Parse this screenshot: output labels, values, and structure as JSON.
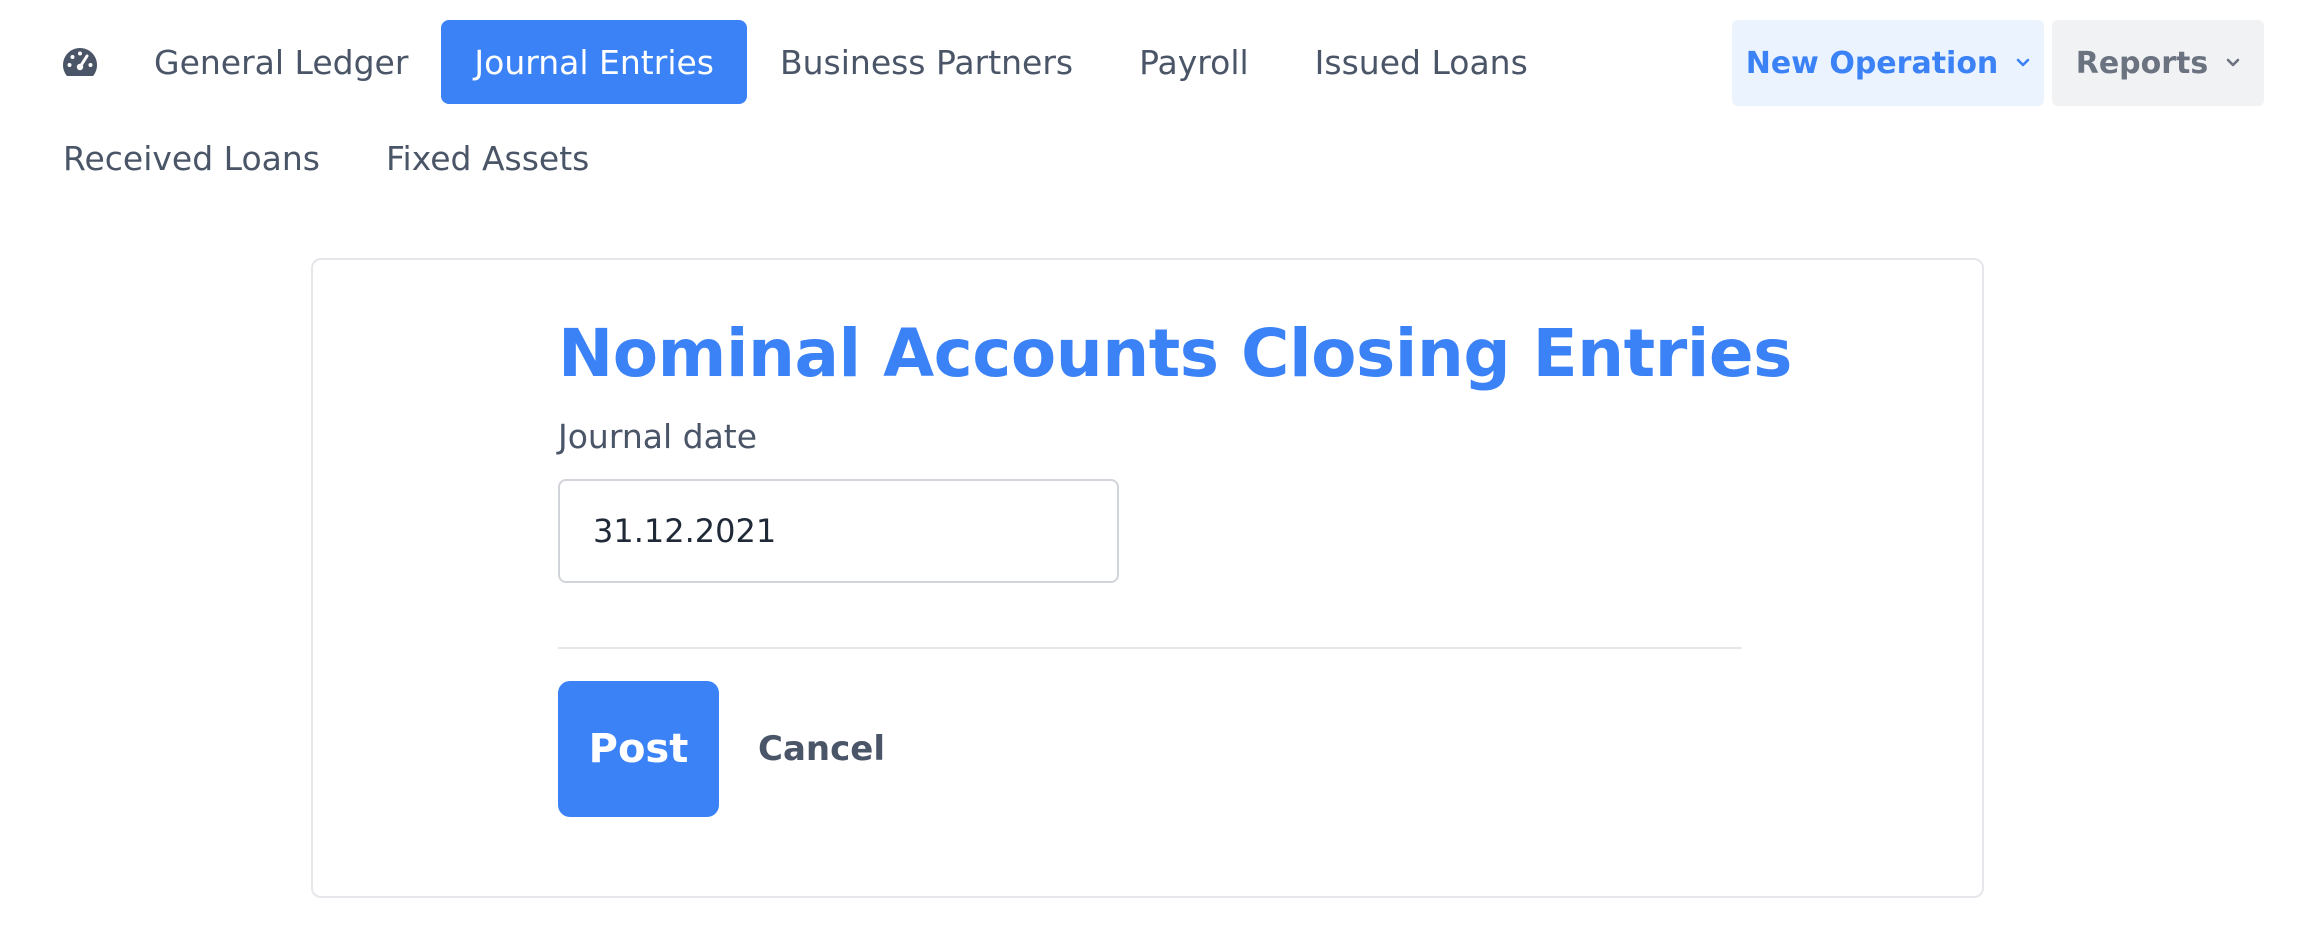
{
  "nav": {
    "dashboard_icon": "dashboard-gauge-icon",
    "row1": [
      {
        "label": "General Ledger",
        "active": false
      },
      {
        "label": "Journal Entries",
        "active": true
      },
      {
        "label": "Business Partners",
        "active": false
      },
      {
        "label": "Payroll",
        "active": false
      },
      {
        "label": "Issued Loans",
        "active": false
      }
    ],
    "row2": [
      {
        "label": "Received Loans",
        "active": false
      },
      {
        "label": "Fixed Assets",
        "active": false
      }
    ],
    "actions": {
      "new_operation": "New Operation",
      "reports": "Reports"
    }
  },
  "form": {
    "title": "Nominal Accounts Closing Entries",
    "journal_date_label": "Journal date",
    "journal_date_value": "31.12.2021",
    "post_label": "Post",
    "cancel_label": "Cancel"
  },
  "colors": {
    "accent": "#3b82f6",
    "accent_light": "#ebf3fe",
    "text": "#4a5568",
    "border": "#e5e7eb"
  }
}
